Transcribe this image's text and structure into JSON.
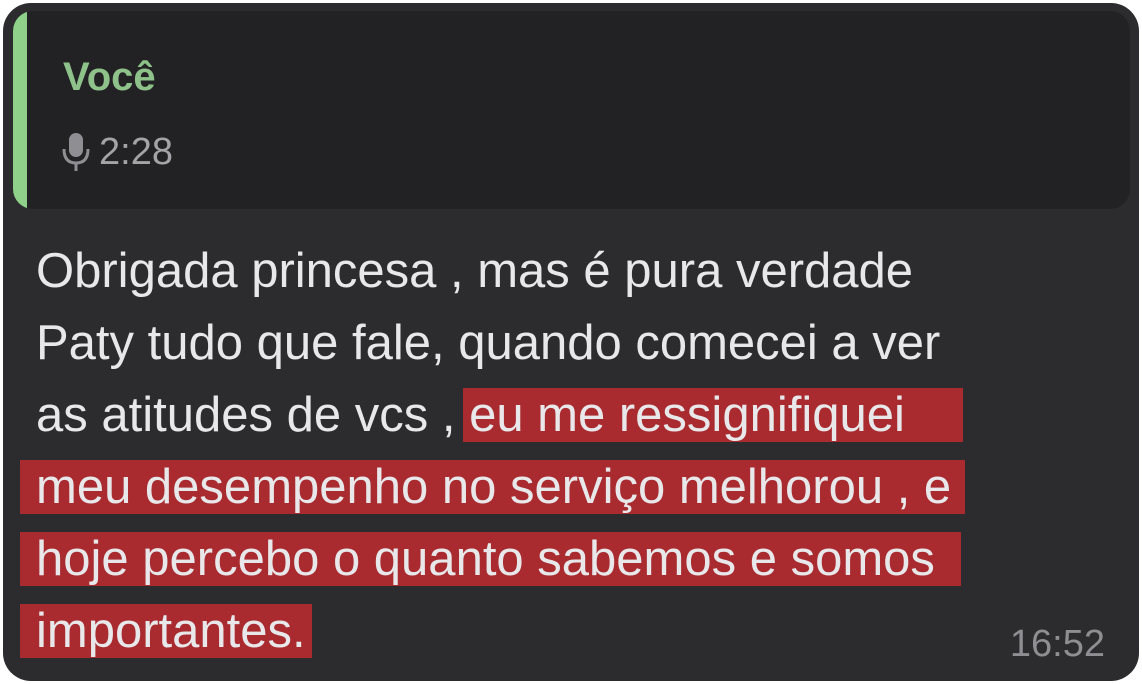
{
  "quoted_message": {
    "author": "Você",
    "voice_icon": "microphone-icon",
    "duration": "2:28"
  },
  "message": {
    "line1": "Obrigada princesa , mas é pura verdade",
    "line2": "Paty tudo que fale, quando comecei a ver",
    "line3_plain": "as atitudes de vcs , ",
    "line3_highlight": "eu me ressignifiquei",
    "line4_highlight": "meu desempenho no serviço melhorou , e",
    "line5_highlight": "hoje percebo o quanto sabemos e somos",
    "line6_highlight": "importantes.",
    "time": "16:52"
  },
  "colors": {
    "bubble": "#2c2c2e",
    "quote_background": "#222224",
    "quote_accent": "#8fd18a",
    "highlight": "#a92b30"
  }
}
